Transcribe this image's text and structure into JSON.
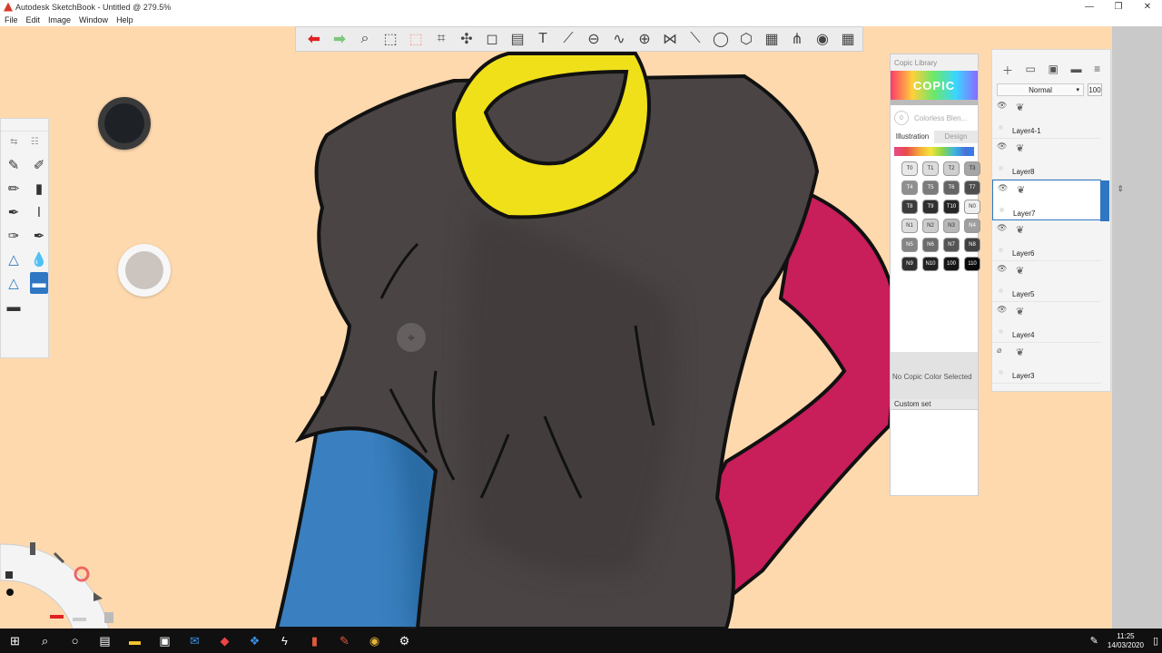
{
  "window": {
    "title": "Autodesk SketchBook - Untitled @ 279.5%"
  },
  "menu": [
    "File",
    "Edit",
    "Image",
    "Window",
    "Help"
  ],
  "toolbar": {
    "icons": [
      "undo-icon",
      "redo-icon",
      "zoom-icon",
      "select-icon",
      "select-alt-icon",
      "crop-icon",
      "transform-icon",
      "distort-icon",
      "fill-icon",
      "text-icon",
      "ruler-icon",
      "ellipse-guide-icon",
      "curve-icon",
      "perspective-icon",
      "symmetry-icon",
      "line-icon",
      "circle-icon",
      "shape-icon",
      "copic-icon",
      "brush-library-icon",
      "color-wheel-icon",
      "grid-icon"
    ]
  },
  "copic": {
    "title": "Copic Library",
    "logo": "COPIC",
    "blender_label": "Colorless Blen...",
    "blender_num": "0",
    "tabs": [
      "Illustration",
      "Design"
    ],
    "swatches": [
      {
        "label": "T0",
        "bg": "#e8e8e8",
        "fg": "#333"
      },
      {
        "label": "T1",
        "bg": "#dcdcdc",
        "fg": "#333"
      },
      {
        "label": "T2",
        "bg": "#cfcfcf",
        "fg": "#333"
      },
      {
        "label": "T3",
        "bg": "#a6a6a6",
        "fg": "#222"
      },
      {
        "label": "T4",
        "bg": "#8f8f8f",
        "fg": "#fff"
      },
      {
        "label": "T5",
        "bg": "#7b7b7b",
        "fg": "#fff"
      },
      {
        "label": "T6",
        "bg": "#656565",
        "fg": "#fff"
      },
      {
        "label": "T7",
        "bg": "#4e4e4e",
        "fg": "#fff"
      },
      {
        "label": "T8",
        "bg": "#3c3c3c",
        "fg": "#fff"
      },
      {
        "label": "T9",
        "bg": "#2f2f2f",
        "fg": "#fff"
      },
      {
        "label": "T10",
        "bg": "#262626",
        "fg": "#fff"
      },
      {
        "label": "N0",
        "bg": "#efefef",
        "fg": "#333"
      },
      {
        "label": "N1",
        "bg": "#dddddd",
        "fg": "#333"
      },
      {
        "label": "N2",
        "bg": "#cccccc",
        "fg": "#333"
      },
      {
        "label": "N3",
        "bg": "#b8b8b8",
        "fg": "#333"
      },
      {
        "label": "N4",
        "bg": "#9f9f9f",
        "fg": "#fff"
      },
      {
        "label": "N5",
        "bg": "#858585",
        "fg": "#fff"
      },
      {
        "label": "N6",
        "bg": "#6c6c6c",
        "fg": "#fff"
      },
      {
        "label": "N7",
        "bg": "#555555",
        "fg": "#fff"
      },
      {
        "label": "N8",
        "bg": "#404040",
        "fg": "#fff"
      },
      {
        "label": "N9",
        "bg": "#303030",
        "fg": "#fff"
      },
      {
        "label": "N10",
        "bg": "#222222",
        "fg": "#fff"
      },
      {
        "label": "100",
        "bg": "#161616",
        "fg": "#fff"
      },
      {
        "label": "110",
        "bg": "#0a0a0a",
        "fg": "#fff"
      }
    ],
    "status": "No Copic Color Selected",
    "custom_set": "Custom set"
  },
  "layers": {
    "blend_mode": "Normal",
    "opacity": "100",
    "items": [
      {
        "name": "Layer4-1",
        "selected": false,
        "visible": true
      },
      {
        "name": "Layer8",
        "selected": false,
        "visible": true
      },
      {
        "name": "Layer7",
        "selected": true,
        "visible": true
      },
      {
        "name": "Layer6",
        "selected": false,
        "visible": true
      },
      {
        "name": "Layer5",
        "selected": false,
        "visible": true
      },
      {
        "name": "Layer4",
        "selected": false,
        "visible": true
      },
      {
        "name": "Layer3",
        "selected": false,
        "visible": false
      }
    ]
  },
  "taskbar": {
    "time": "11:25",
    "date": "14/03/2020"
  },
  "colors": {
    "canvas_bg": "#ffd9ae",
    "fur": "#4a4444",
    "yellow": "#f0e01a",
    "blue": "#3a7fbf",
    "pink": "#c81e5a",
    "current_color": "#1e2226"
  }
}
